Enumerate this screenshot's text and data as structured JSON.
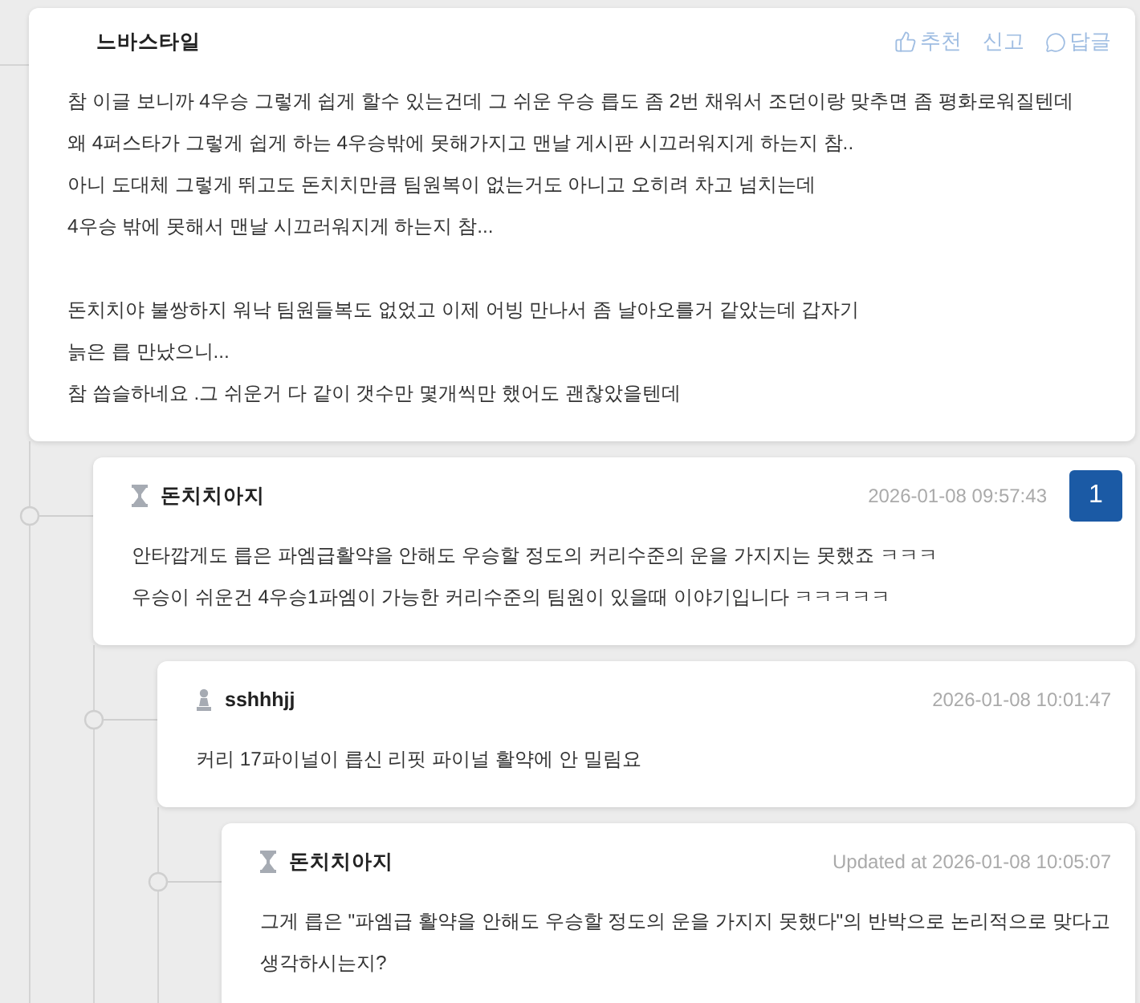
{
  "thread": {
    "author": "느바스타일",
    "actions": [
      {
        "kind": "like",
        "label": "추천"
      },
      {
        "kind": "report",
        "label": "신고"
      },
      {
        "kind": "reply",
        "label": "답글"
      }
    ],
    "paragraphs": [
      [
        "참 이글 보니까 4우승 그렇게 쉽게 할수 있는건데 그 쉬운 우승 릅도 좀 2번 채워서 조던이랑 맞추면 좀 평화로워질텐데",
        "왜 4퍼스타가 그렇게 쉽게 하는 4우승밖에 못해가지고 맨날 게시판 시끄러워지게 하는지 참..",
        "아니 도대체 그렇게 뛰고도 돈치치만큼 팀원복이 없는거도 아니고 오히려 차고 넘치는데",
        "4우승 밖에 못해서 맨날 시끄러워지게 하는지 참..."
      ],
      [
        "돈치치야 불쌍하지 워낙 팀원들복도 없었고 이제 어빙 만나서 좀 날아오를거 같았는데 갑자기",
        "늙은 릅 만났으니...",
        "참 씁슬하네요 .그 쉬운거 다 같이 갯수만 몇개씩만 했어도 괜찮았을텐데"
      ]
    ],
    "children": [
      {
        "kind": "hourglass",
        "author": "돈치치아지",
        "time": "2026-01-08 09:57:43",
        "badge": "1",
        "paragraphs": [
          [
            "안타깝게도 릅은 파엠급활약을 안해도 우승할 정도의 커리수준의 운을 가지지는 못했죠 ㅋㅋㅋ",
            "우승이 쉬운건 4우승1파엠이 가능한 커리수준의 팀원이 있을때 이야기입니다 ㅋㅋㅋㅋㅋ"
          ]
        ],
        "children": [
          {
            "kind": "pawn",
            "author": "sshhhjj",
            "time": "2026-01-08 10:01:47",
            "paragraphs": [
              [
                "커리 17파이널이 릅신 리핏 파이널 활약에 안 밀림요"
              ]
            ],
            "children": [
              {
                "kind": "hourglass",
                "author": "돈치치아지",
                "time": "Updated at 2026-01-08 10:05:07",
                "paragraphs": [
                  [
                    "그게 릅은 \"파엠급 활약을 안해도 우승할 정도의 운을 가지지 못했다\"의 반박으로 논리적으로 맞다고 생각하시는지?"
                  ]
                ]
              }
            ]
          }
        ]
      }
    ]
  }
}
